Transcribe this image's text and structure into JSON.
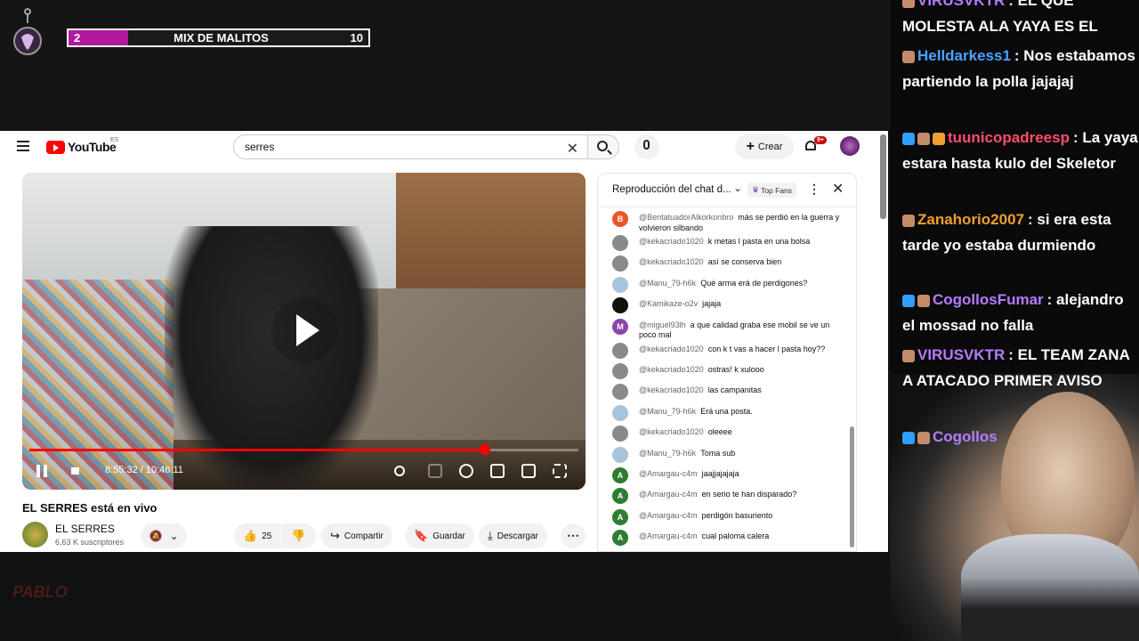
{
  "stream_overlay": {
    "mix_left": "2",
    "mix_title": "MIX DE MALITOS",
    "mix_right": "10",
    "mix_progress": 0.2
  },
  "youtube": {
    "brand": "YouTube",
    "region": "ES",
    "search_value": "serres",
    "create_label": "Crear",
    "notif_badge": "9+",
    "player": {
      "time": "8:55:32 / 10:46:11",
      "progress": 0.83
    },
    "video_title": "EL SERRES está en vivo",
    "channel_name": "EL SERRES",
    "channel_subs": "6,63 K suscriptores",
    "likes": "25",
    "share_label": "Compartir",
    "save_label": "Guardar",
    "download_label": "Descargar"
  },
  "chat": {
    "title": "Reproducción del chat d...",
    "top_fans_label": "Top Fans",
    "messages": [
      {
        "initial": "B",
        "color": "#e8552b",
        "author": "@BentatuadorAlkorkonbro",
        "text": "más se perdió en la guerra y volvieron silbando"
      },
      {
        "initial": "",
        "color": "#8a8a8a",
        "author": "@kekacriado1020",
        "text": "k metas l pasta en una bolsa"
      },
      {
        "initial": "",
        "color": "#8a8a8a",
        "author": "@kekacriado1020",
        "text": "así se conserva bien"
      },
      {
        "initial": "",
        "color": "#a8c4dc",
        "author": "@Manu_79-h6k",
        "text": "Qué arma erá de perdigones?"
      },
      {
        "initial": "",
        "color": "#111111",
        "author": "@Kamikaze-o2v",
        "text": "jajaja"
      },
      {
        "initial": "M",
        "color": "#8e44ad",
        "author": "@miguel93lh",
        "text": "a que calidad graba ese mobil se ve un poco mal"
      },
      {
        "initial": "",
        "color": "#8a8a8a",
        "author": "@kekacriado1020",
        "text": "con k t vas a hacer l pasta hoy??"
      },
      {
        "initial": "",
        "color": "#8a8a8a",
        "author": "@kekacriado1020",
        "text": "ostras! k xulooo"
      },
      {
        "initial": "",
        "color": "#8a8a8a",
        "author": "@kekacriado1020",
        "text": "las campanitas"
      },
      {
        "initial": "",
        "color": "#a8c4dc",
        "author": "@Manu_79-h6k",
        "text": "Erá una posta."
      },
      {
        "initial": "",
        "color": "#8a8a8a",
        "author": "@kekacriado1020",
        "text": "oleeee"
      },
      {
        "initial": "",
        "color": "#a8c4dc",
        "author": "@Manu_79-h6k",
        "text": "Toma sub"
      },
      {
        "initial": "A",
        "color": "#2e7d32",
        "author": "@Amargau-c4m",
        "text": "jaajjajajaja"
      },
      {
        "initial": "A",
        "color": "#2e7d32",
        "author": "@Amargau-c4m",
        "text": "en serio te han disparado?"
      },
      {
        "initial": "A",
        "color": "#2e7d32",
        "author": "@Amargau-c4m",
        "text": "perdigón basuriento"
      },
      {
        "initial": "A",
        "color": "#2e7d32",
        "author": "@Amargau-c4m",
        "text": "cual paloma calera"
      }
    ]
  },
  "twitch_chat": [
    {
      "name": "VIRUSVKTR",
      "name_color": "#b57cff",
      "text": ": EL QUE MOLESTA ALA YAYA ES EL"
    },
    {
      "name": "Helldarkess1",
      "name_color": "#4aa3ff",
      "text": ": Nos estabamos partiendo la polla jajajaj"
    },
    {
      "name": "tuunicopadreesp",
      "name_color": "#ff4d6d",
      "text": ": La yaya estara hasta kulo del Skeletor"
    },
    {
      "name": "Zanahorio2007",
      "name_color": "#f0a030",
      "text": ": si era esta tarde yo estaba durmiendo"
    },
    {
      "name": "CogollosFumar",
      "name_color": "#b57cff",
      "text": ": alejandro el mossad no falla"
    },
    {
      "name": "VIRUSVKTR",
      "name_color": "#b57cff",
      "text": ": EL TEAM ZANA A ATACADO PRIMER AVISO"
    },
    {
      "name": "Cogollos",
      "name_color": "#b57cff",
      "text": ""
    }
  ],
  "watermark": "PABLO"
}
